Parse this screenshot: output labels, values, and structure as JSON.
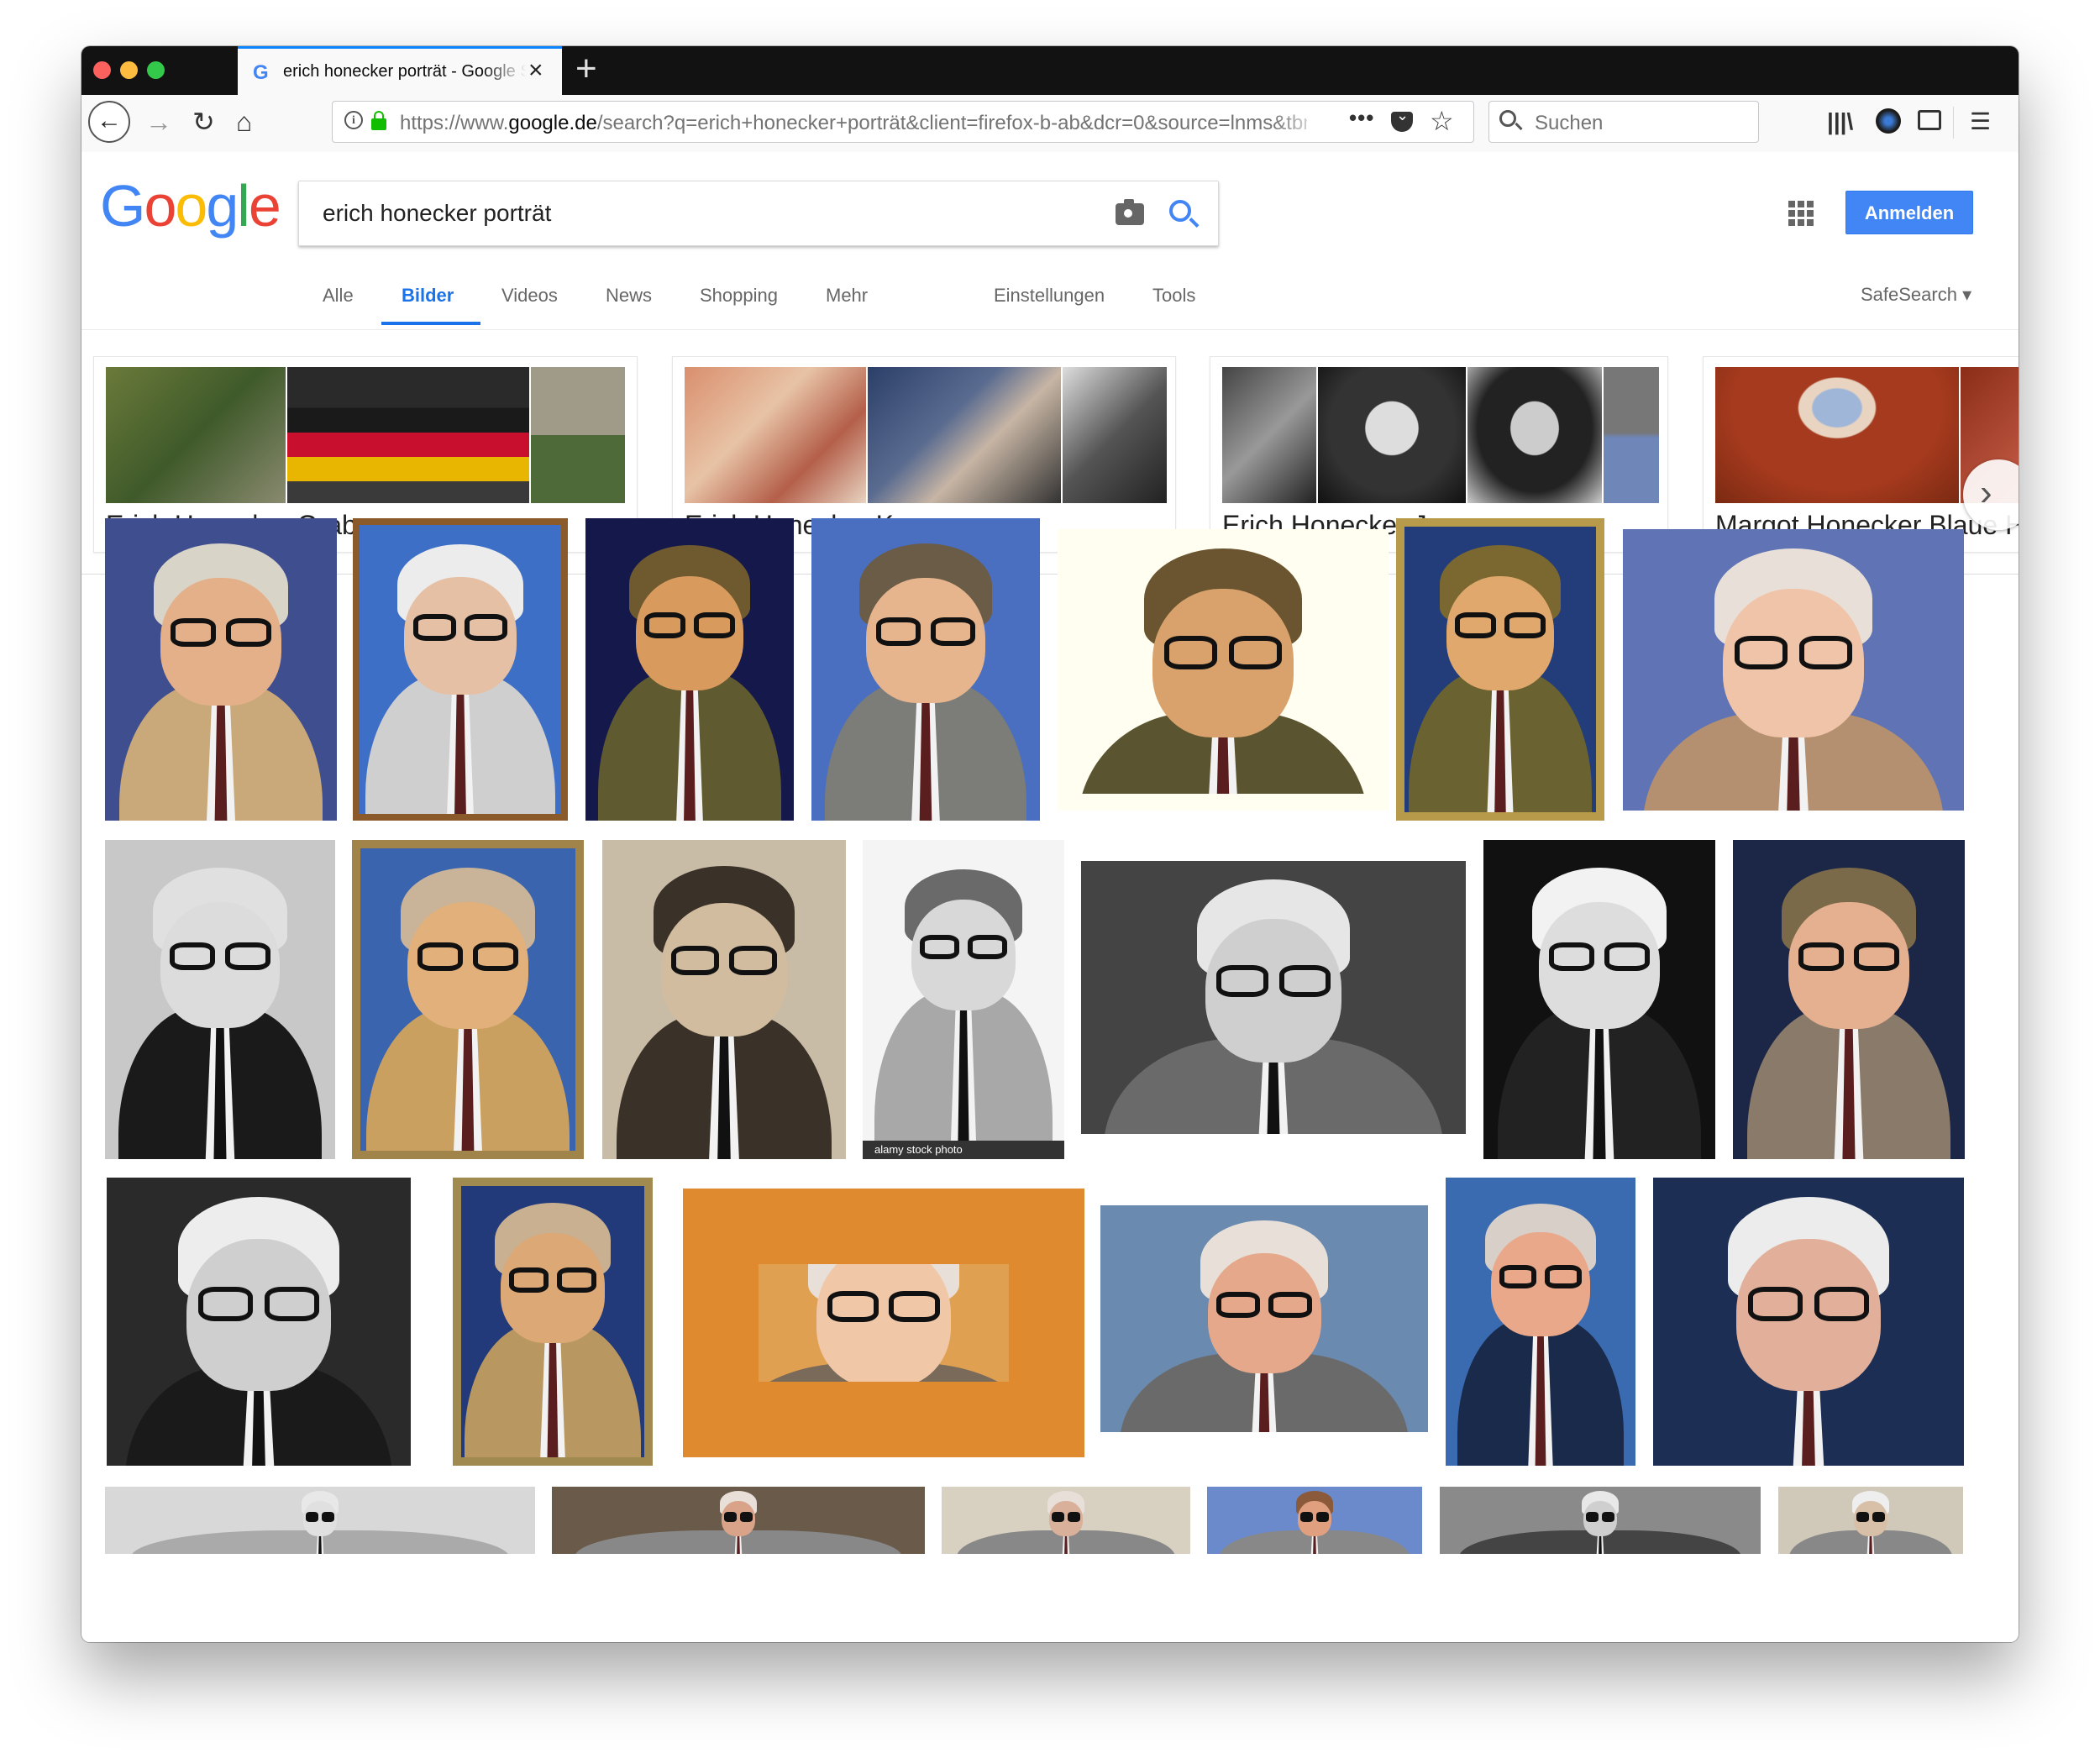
{
  "browser": {
    "tab_title": "erich honecker porträt - Google Suche",
    "url_prefix": "https://www.",
    "url_domain": "google.de",
    "url_rest": "/search?q=erich+honecker+porträt&client=firefox-b-ab&dcr=0&source=lnms&tbm=isch",
    "search_placeholder": "Suchen",
    "icons": [
      "back-icon",
      "forward-icon",
      "reload-icon",
      "home-icon",
      "info-icon",
      "lock-icon",
      "page-actions-icon",
      "pocket-icon",
      "bookmark-star-icon",
      "library-icon",
      "extension-icon",
      "sidebar-icon",
      "menu-icon"
    ]
  },
  "google": {
    "logo": "Google",
    "logo_colors": [
      "#4285f4",
      "#ea4335",
      "#fbbc05",
      "#4285f4",
      "#34a853",
      "#ea4335"
    ],
    "query": "erich honecker porträt",
    "signin_label": "Anmelden",
    "tabs": [
      "Alle",
      "Bilder",
      "Videos",
      "News",
      "Shopping",
      "Mehr"
    ],
    "active_tab": "Bilder",
    "tools": [
      "Einstellungen",
      "Tools"
    ],
    "safesearch": "SafeSearch ▾"
  },
  "related": [
    {
      "label": "Erich Honecker Grab"
    },
    {
      "label": "Erich Honecker Kuss"
    },
    {
      "label": "Erich Honecker Jung"
    },
    {
      "label": "Margot Honecker Blaue Haare"
    }
  ],
  "watermark": "alamy stock photo",
  "colors": {
    "accent": "#1a73e8",
    "signin": "#4285f4",
    "tab_highlight": "#0a84ff"
  }
}
